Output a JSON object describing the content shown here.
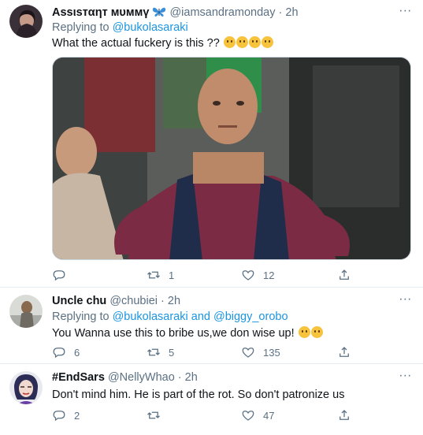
{
  "tweets": [
    {
      "name": "Assιѕтαηт мυммү",
      "handle": "@iamsandramonday",
      "time": "2h",
      "replying_label": "Replying to",
      "replying_to": "@bukolasaraki",
      "text": "What the actual fuckery is this ??",
      "emoji_count": 4,
      "name_icon": "butterfly-emoji-icon",
      "actions": {
        "reply": "",
        "retweet": "1",
        "like": "12"
      },
      "has_media": true
    },
    {
      "name": "Uncle chu",
      "handle": "@chubiei",
      "time": "2h",
      "replying_label": "Replying to",
      "replying_to": "@bukolasaraki",
      "replying_and": "and",
      "replying_to_2": "@biggy_orobo",
      "text": "You Wanna use this to bribe us,we don wise up!",
      "emoji_count": 2,
      "actions": {
        "reply": "6",
        "retweet": "5",
        "like": "135"
      }
    },
    {
      "name": "#EndSars",
      "handle": "@NellyWhao",
      "time": "2h",
      "text": "Don't mind him. He is part of the rot. So don't patronize us",
      "actions": {
        "reply": "2",
        "retweet": "",
        "like": "47"
      }
    }
  ],
  "colors": {
    "link": "#1b95e0",
    "secondary": "#5b7083",
    "divider": "#e6ecf0"
  },
  "separator": "·",
  "more_glyph": "∙∙∙"
}
